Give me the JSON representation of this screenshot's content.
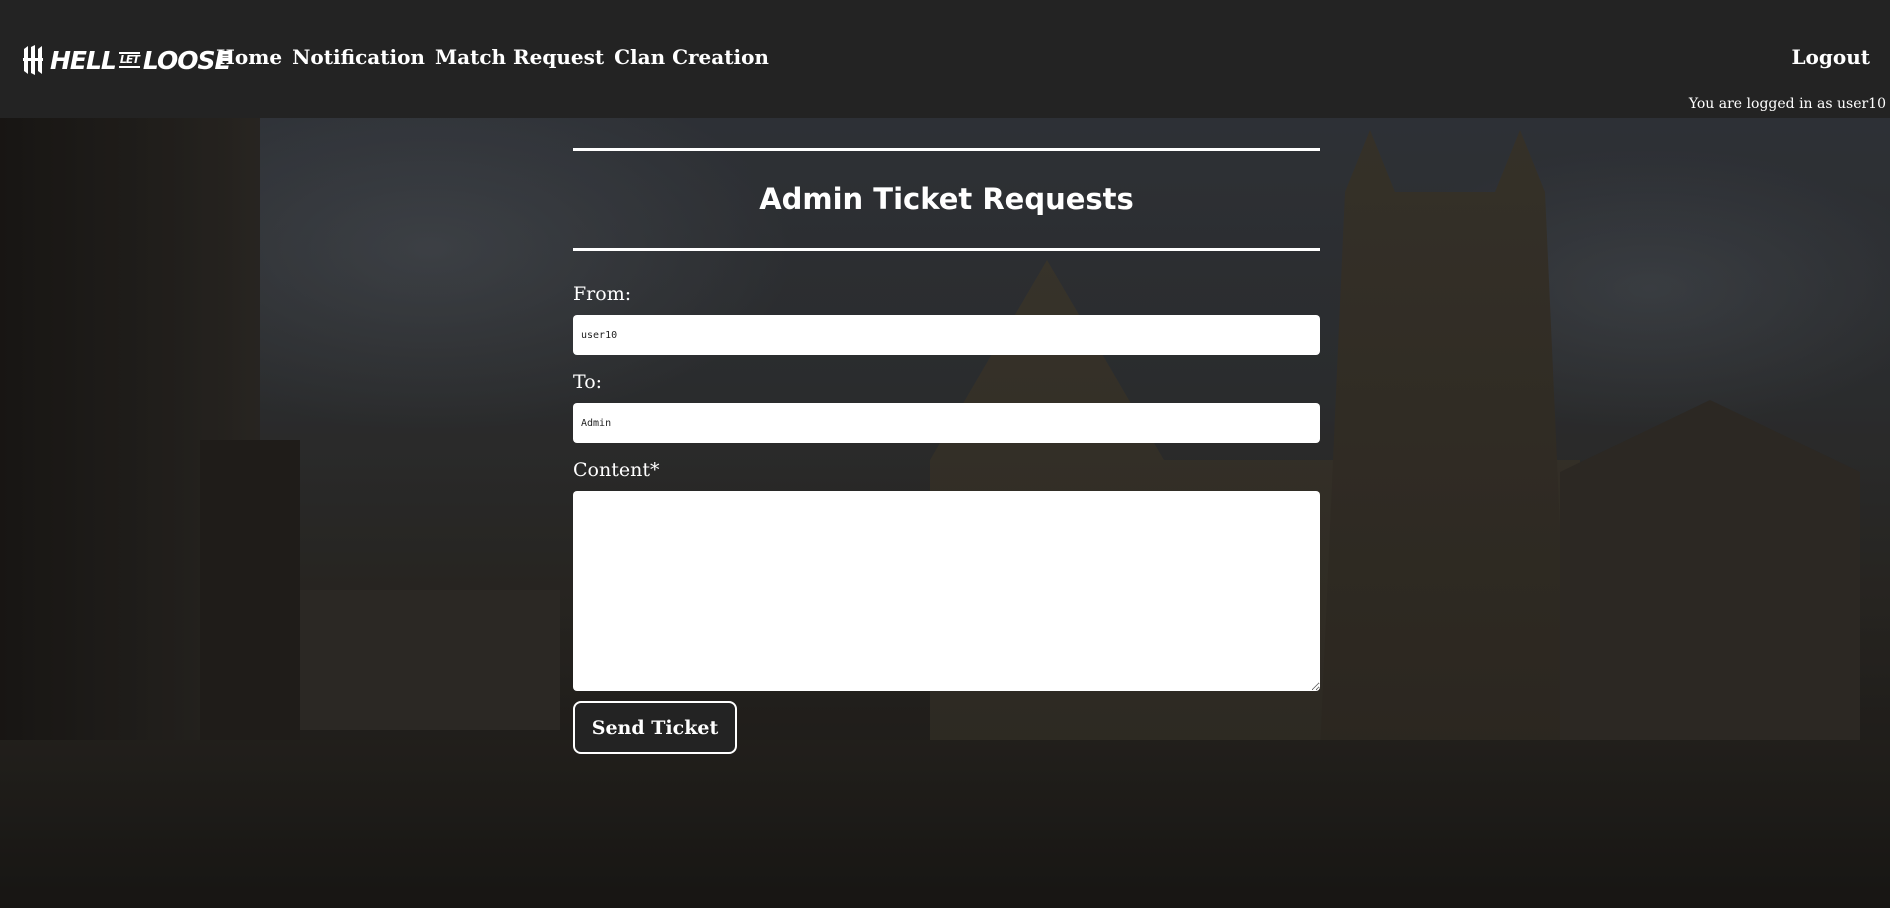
{
  "header": {
    "logo": {
      "part1": "HELL",
      "part2": "LET",
      "part3": "LOOSE"
    },
    "nav": [
      {
        "label": "Home"
      },
      {
        "label": "Notification"
      },
      {
        "label": "Match Request"
      },
      {
        "label": "Clan Creation"
      }
    ],
    "logout_label": "Logout",
    "logged_in_text": "You are logged in as user10"
  },
  "form": {
    "title": "Admin Ticket Requests",
    "from_label": "From:",
    "from_value": "user10",
    "to_label": "To:",
    "to_value": "Admin",
    "content_label": "Content*",
    "content_value": "",
    "submit_label": "Send Ticket"
  }
}
